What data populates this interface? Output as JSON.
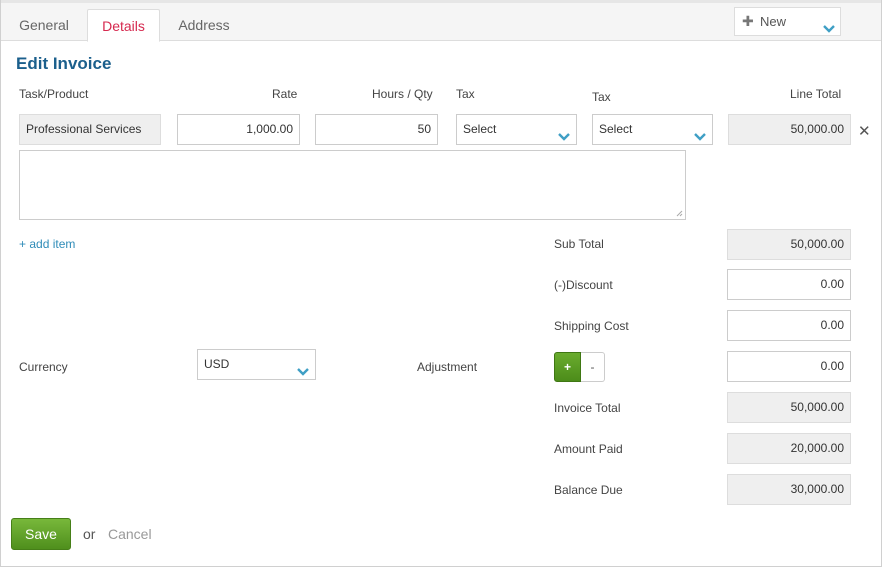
{
  "tabs": [
    {
      "label": "General"
    },
    {
      "label": "Details"
    },
    {
      "label": "Address"
    }
  ],
  "new_button": {
    "label": "New",
    "icon": "plus-icon"
  },
  "form": {
    "title": "Edit Invoice"
  },
  "columns": {
    "task": "Task/Product",
    "rate": "Rate",
    "hours": "Hours / Qty",
    "tax1": "Tax",
    "tax2": "Tax",
    "line_total": "Line Total"
  },
  "line_item": {
    "task": "Professional Services",
    "rate": "1,000.00",
    "hours": "50",
    "tax1": "Select",
    "tax2": "Select",
    "line_total": "50,000.00",
    "description": ""
  },
  "add_item": "+ add item",
  "currency": {
    "label": "Currency",
    "value": "USD"
  },
  "adjustment": {
    "label": "Adjustment",
    "plus": "+",
    "minus": "-"
  },
  "totals": {
    "sub_total": {
      "label": "Sub Total",
      "value": "50,000.00"
    },
    "discount": {
      "label": "(-)Discount",
      "value": "0.00"
    },
    "shipping": {
      "label": "Shipping Cost",
      "value": "0.00"
    },
    "adjustment_value": "0.00",
    "invoice_total": {
      "label": "Invoice Total",
      "value": "50,000.00"
    },
    "amount_paid": {
      "label": "Amount Paid",
      "value": "20,000.00"
    },
    "balance_due": {
      "label": "Balance Due",
      "value": "30,000.00"
    }
  },
  "actions": {
    "save": "Save",
    "or": "or",
    "cancel": "Cancel"
  },
  "colors": {
    "accent_tab": "#d6294f",
    "title": "#1b5f8c",
    "link": "#2f8cb8",
    "save": "#5fa127"
  }
}
